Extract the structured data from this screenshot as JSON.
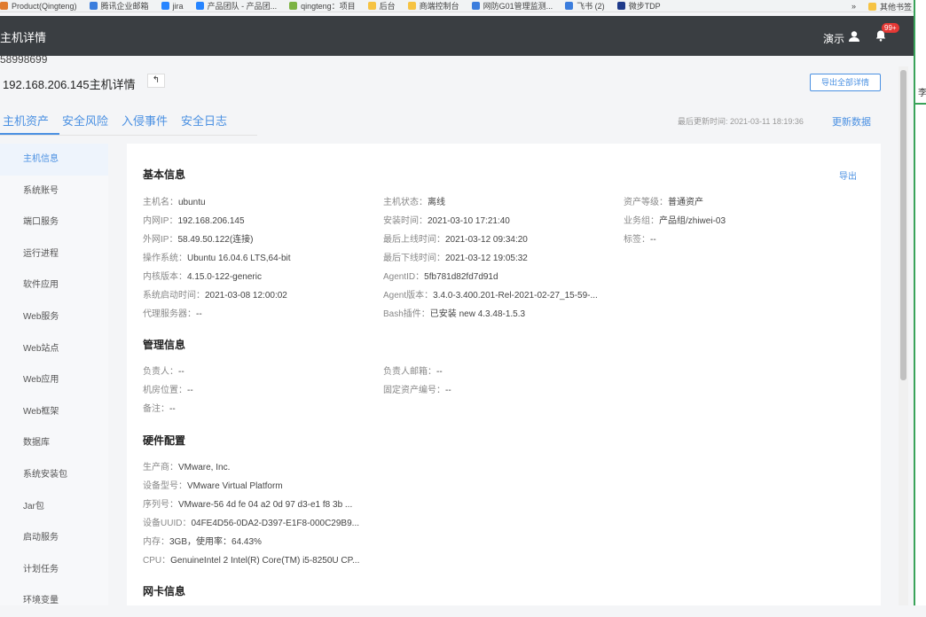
{
  "bookmarks": [
    {
      "label": "Product(Qingteng)",
      "color": "#e07b2e"
    },
    {
      "label": "腾讯企业邮箱",
      "color": "#3b7ddd"
    },
    {
      "label": "jira",
      "color": "#2684ff"
    },
    {
      "label": "产品团队 - 产品团...",
      "color": "#2684ff"
    },
    {
      "label": "qingteng：项目",
      "color": "#7cb342"
    },
    {
      "label": "后台",
      "color": "#f6c343"
    },
    {
      "label": "商端控制台",
      "color": "#f6c343"
    },
    {
      "label": "网防G01管理监测...",
      "color": "#3b7ddd"
    },
    {
      "label": "飞书 (2)",
      "color": "#3b7ddd"
    },
    {
      "label": "微步TDP",
      "color": "#1e3a8a"
    }
  ],
  "bookmarks_more": "»",
  "bookmarks_other": "其他书签",
  "right_strip_char": "李",
  "header": {
    "title": "主机详情",
    "demo": "演示",
    "badge": "99+"
  },
  "user_id": "58998699",
  "page": {
    "title": "192.168.206.145主机详情",
    "back": "↰",
    "export_all": "导出全部详情"
  },
  "tabs": [
    "主机资产",
    "安全风险",
    "入侵事件",
    "安全日志"
  ],
  "last_update": "最后更新时间: 2021-03-11 18:19:36",
  "refresh": "更新数据",
  "sidebar": [
    "主机信息",
    "系统账号",
    "端口服务",
    "运行进程",
    "软件应用",
    "Web服务",
    "Web站点",
    "Web应用",
    "Web框架",
    "数据库",
    "系统安装包",
    "Jar包",
    "启动服务",
    "计划任务",
    "环境变量"
  ],
  "sections": {
    "basic": "基本信息",
    "manage": "管理信息",
    "hardware": "硬件配置",
    "nic": "网卡信息",
    "export": "导出"
  },
  "basic_col1": [
    {
      "k": "主机名：",
      "v": "ubuntu"
    },
    {
      "k": "内网IP：",
      "v": "192.168.206.145"
    },
    {
      "k": "外网IP：",
      "v": "58.49.50.122(连接)"
    },
    {
      "k": "操作系统：",
      "v": "Ubuntu 16.04.6 LTS,64-bit"
    },
    {
      "k": "内核版本：",
      "v": "4.15.0-122-generic"
    },
    {
      "k": "系统启动时间：",
      "v": "2021-03-08 12:00:02"
    },
    {
      "k": "代理服务器：",
      "v": "--"
    }
  ],
  "basic_col2": [
    {
      "k": "主机状态：",
      "v": "离线"
    },
    {
      "k": "安装时间：",
      "v": "2021-03-10 17:21:40"
    },
    {
      "k": "最后上线时间：",
      "v": "2021-03-12 09:34:20"
    },
    {
      "k": "最后下线时间：",
      "v": "2021-03-12 19:05:32"
    },
    {
      "k": "AgentID：",
      "v": "5fb781d82fd7d91d"
    },
    {
      "k": "Agent版本：",
      "v": "3.4.0-3.400.201-Rel-2021-02-27_15-59-..."
    },
    {
      "k": "Bash插件：",
      "v": "已安装 new 4.3.48-1.5.3"
    }
  ],
  "basic_col3": [
    {
      "k": "资产等级：",
      "v": "普通资产"
    },
    {
      "k": "业务组：",
      "v": "产品组/zhiwei-03"
    },
    {
      "k": "标签：",
      "v": "--"
    }
  ],
  "manage_col1": [
    {
      "k": "负责人：",
      "v": "--"
    },
    {
      "k": "机房位置：",
      "v": "--"
    },
    {
      "k": "备注：",
      "v": "--"
    }
  ],
  "manage_col2": [
    {
      "k": "负责人邮箱：",
      "v": "--"
    },
    {
      "k": "固定资产编号：",
      "v": "--"
    }
  ],
  "hardware": [
    {
      "k": "生产商：",
      "v": "VMware, Inc."
    },
    {
      "k": "设备型号：",
      "v": "VMware Virtual Platform"
    },
    {
      "k": "序列号：",
      "v": "VMware-56 4d fe 04 a2 0d 97 d3-e1 f8 3b ..."
    },
    {
      "k": "设备UUID：",
      "v": "04FE4D56-0DA2-D397-E1F8-000C29B9..."
    },
    {
      "k": "内存：",
      "v": "3GB，使用率：64.43%"
    },
    {
      "k": "CPU：",
      "v": "GenuineIntel 2 Intel(R) Core(TM) i5-8250U CP..."
    }
  ]
}
